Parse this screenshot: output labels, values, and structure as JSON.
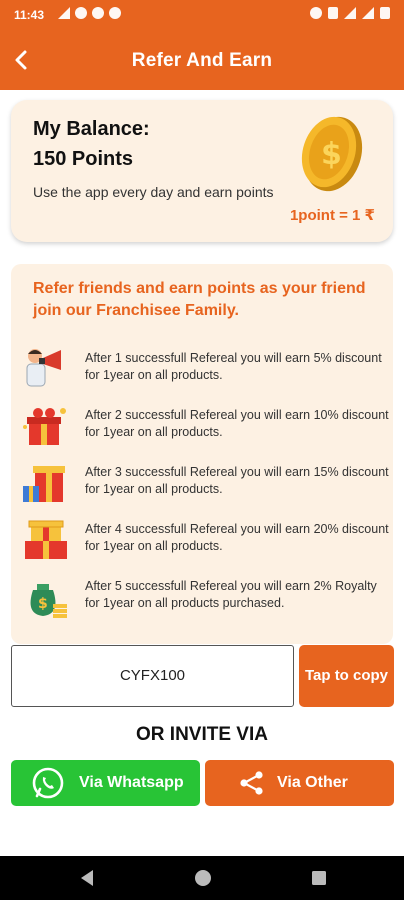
{
  "status_bar": {
    "time": "11:43"
  },
  "app_bar": {
    "title": "Refer And Earn"
  },
  "balance": {
    "label": "My Balance:",
    "points": "150  Points",
    "description": "Use the app every day and earn points",
    "rate": "1point = 1 ₹"
  },
  "refer": {
    "headline": "Refer friends and earn points as your friend join our Franchisee Family.",
    "rules": [
      {
        "text": "After 1 successfull Refereal you will earn 5% discount for 1year on all products.",
        "icon": "megaphone-icon"
      },
      {
        "text": "After 2 successfull Refereal you will earn 10% discount for 1year on all products.",
        "icon": "gift-icon"
      },
      {
        "text": "After 3 successfull Refereal you will earn 15% discount for 1year on all products.",
        "icon": "gifts-icon"
      },
      {
        "text": "After 4 successfull Refereal you will earn 20% discount for 1year on all products.",
        "icon": "gift-stack-icon"
      },
      {
        "text": "After 5 successfull Refereal you will earn 2% Royalty for 1year on all products purchased.",
        "icon": "money-bag-icon"
      }
    ]
  },
  "code": {
    "value": "CYFX100",
    "copy_label": "Tap to copy"
  },
  "invite": {
    "heading": "OR INVITE VIA",
    "whatsapp_label": "Via Whatsapp",
    "other_label": "Via Other"
  },
  "colors": {
    "accent": "#E7641F",
    "card": "#FDF1E3",
    "whatsapp": "#28C436"
  }
}
